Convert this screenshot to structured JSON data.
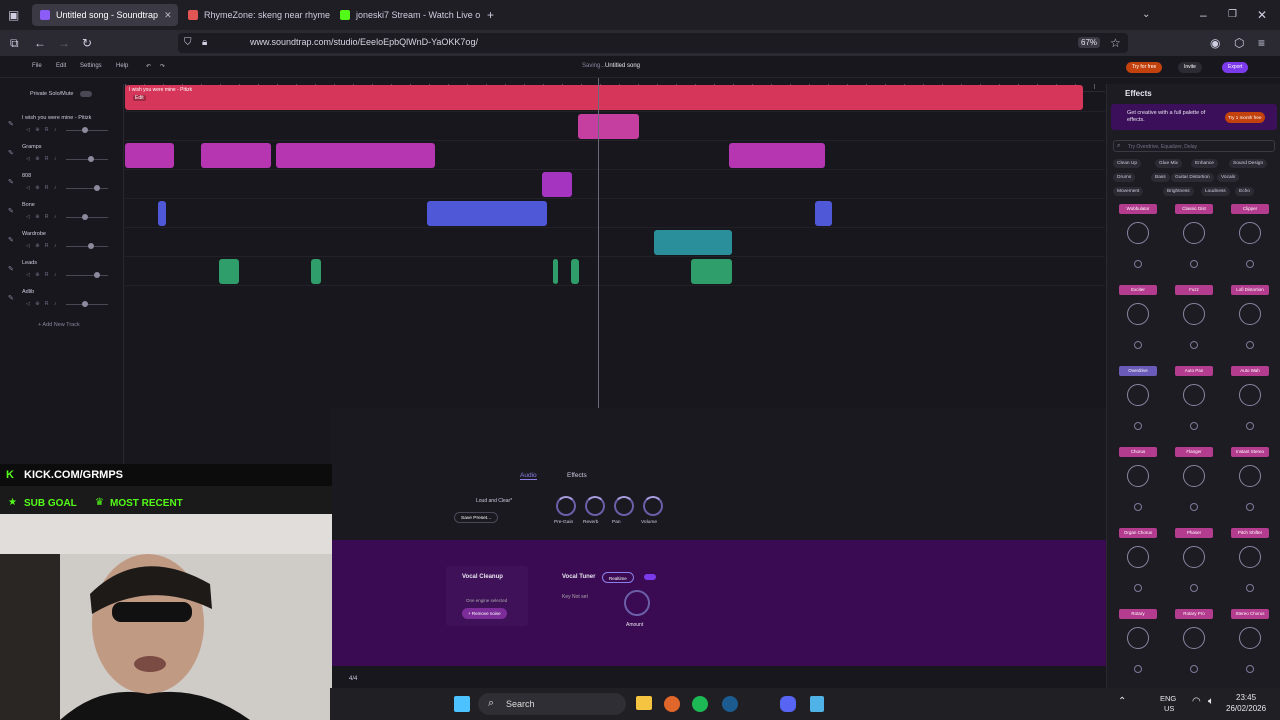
{
  "browser": {
    "tabs": [
      {
        "title": "Untitled song - Soundtrap",
        "color": "#8b5cf6"
      },
      {
        "title": "RhymeZone: skeng near rhymes",
        "color": "#e25555"
      },
      {
        "title": "joneski7 Stream - Watch Live o",
        "color": "#53fc18"
      }
    ],
    "url": "www.soundtrap.com/studio/EeeloEpbQlWnD-YaOKK7og/",
    "zoom": "67%"
  },
  "app": {
    "menus": [
      "File",
      "Edit",
      "Settings",
      "Help"
    ],
    "saving_status": "Saving...",
    "song_title": "Untitled song",
    "try_for_free": "Try for free",
    "invite": "Invite",
    "export": "Export",
    "private_solo_mute": "Private Solo/Mute",
    "add_new_track": "+ Add New Track",
    "tracks": [
      {
        "name": "I wish you were mine - Pitizk",
        "color": "#d6365a"
      },
      {
        "name": "Gramps",
        "color": "#c43fa0"
      },
      {
        "name": "808",
        "color": "#b635b0"
      },
      {
        "name": "Bone",
        "color": "#a535c0"
      },
      {
        "name": "Wardrobe",
        "color": "#4f58d6"
      },
      {
        "name": "Leads",
        "color": "#2a8f9a"
      },
      {
        "name": "Adlib",
        "color": "#2f9e6a"
      }
    ],
    "first_clip_label": "I wish you were mine - Pitizk",
    "first_clip_edit": "Edit"
  },
  "effects": {
    "title": "Effects",
    "promo": "Get creative with a full palette of effects.",
    "promo_button": "Try 1 month free",
    "search_placeholder": "Try Overdrive, Equalizer, Delay",
    "chips": [
      "Clean Up",
      "Glue Mix",
      "Enhance",
      "Sound Design",
      "Drums",
      "Bass",
      "Guitar Distortion",
      "Vocals",
      "Movement",
      "Brightness",
      "Loudness",
      "Echo"
    ],
    "cards": [
      {
        "name": "Wobbulator",
        "color": "#b43c8f"
      },
      {
        "name": "Classic Dist",
        "color": "#b43c8f"
      },
      {
        "name": "Clipper",
        "color": "#b43c8f"
      },
      {
        "name": "Exciter",
        "color": "#b43c8f"
      },
      {
        "name": "Fuzz",
        "color": "#b43c8f"
      },
      {
        "name": "Lofi Distortion",
        "color": "#b43c8f"
      },
      {
        "name": "Overdrive",
        "color": "#6b5bb8"
      },
      {
        "name": "Auto Pan",
        "color": "#b43c8f"
      },
      {
        "name": "Auto Wah",
        "color": "#b43c8f"
      },
      {
        "name": "Chorus",
        "color": "#b43c8f"
      },
      {
        "name": "Flanger",
        "color": "#b43c8f"
      },
      {
        "name": "Instant Stereo",
        "color": "#b43c8f"
      },
      {
        "name": "Organ Chorus",
        "color": "#b43c8f"
      },
      {
        "name": "Phaser",
        "color": "#b43c8f"
      },
      {
        "name": "Pitch Shifter",
        "color": "#b43c8f"
      },
      {
        "name": "Rotary",
        "color": "#b43c8f"
      },
      {
        "name": "Rotary Pro",
        "color": "#b43c8f"
      },
      {
        "name": "Stereo Chorus",
        "color": "#b43c8f"
      }
    ]
  },
  "bottom": {
    "tab_audio": "Audio",
    "tab_effects": "Effects",
    "preset": "Loud and Clear*",
    "save_preset": "Save Preset...",
    "knobs": [
      "Pre-Gain",
      "Reverb",
      "Pan",
      "Volume"
    ],
    "vocal_cleanup": "Vocal Cleanup",
    "vocal_cleanup_sub": "One engine selected",
    "remove_noise": "+ Remove noise",
    "vocal_tuner": "Vocal Tuner",
    "realtime": "Realtime",
    "key_not_set": "Key Not set",
    "amount": "Amount",
    "time_sig": "4/4"
  },
  "stream": {
    "channel": "KICK.COM/GRMPS",
    "sub_goal": "SUB GOAL",
    "most_recent": "MOST RECENT"
  },
  "taskbar": {
    "search": "Search",
    "lang": "ENG",
    "region": "US",
    "time": "23:45",
    "date": "26/02/2026"
  }
}
